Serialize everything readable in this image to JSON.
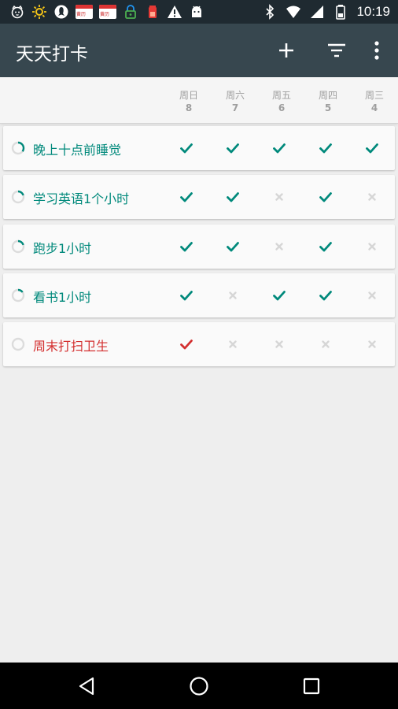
{
  "status_bar": {
    "time": "10:19",
    "calendar_label": "黄历",
    "icons_left": [
      "cat-face-icon",
      "sun-icon",
      "qq-icon",
      "calendar-icon",
      "calendar-icon",
      "lock-icon",
      "battery-app-icon",
      "warning-icon",
      "android-icon"
    ],
    "icons_right": [
      "bluetooth-icon",
      "wifi-icon",
      "cellular-icon",
      "battery-icon"
    ]
  },
  "app_bar": {
    "title": "天天打卡",
    "actions": [
      "add-icon",
      "filter-icon",
      "overflow-menu-icon"
    ]
  },
  "days": [
    {
      "name": "周日",
      "date": "8"
    },
    {
      "name": "周六",
      "date": "7"
    },
    {
      "name": "周五",
      "date": "6"
    },
    {
      "name": "周四",
      "date": "5"
    },
    {
      "name": "周三",
      "date": "4"
    }
  ],
  "habits": [
    {
      "name": "晚上十点前睡觉",
      "color": "#00897b",
      "score": 0.35,
      "checks": [
        true,
        true,
        true,
        true,
        true
      ]
    },
    {
      "name": "学习英语1个小时",
      "color": "#00897b",
      "score": 0.2,
      "checks": [
        true,
        true,
        false,
        true,
        false
      ]
    },
    {
      "name": "跑步1小时",
      "color": "#00897b",
      "score": 0.2,
      "checks": [
        true,
        true,
        false,
        true,
        false
      ]
    },
    {
      "name": "看书1小时",
      "color": "#00897b",
      "score": 0.15,
      "checks": [
        true,
        false,
        true,
        true,
        false
      ]
    },
    {
      "name": "周末打扫卫生",
      "color": "#d32f2f",
      "score": 0.0,
      "checks": [
        true,
        false,
        false,
        false,
        false
      ]
    }
  ],
  "colors": {
    "app_bar": "#37474f",
    "status_bar": "#1f2a31",
    "check_teal": "#00897b",
    "check_red": "#d32f2f",
    "unchecked": "#d6d6d6"
  },
  "nav_bar": {
    "buttons": [
      "back-icon",
      "home-icon",
      "recents-icon"
    ]
  }
}
